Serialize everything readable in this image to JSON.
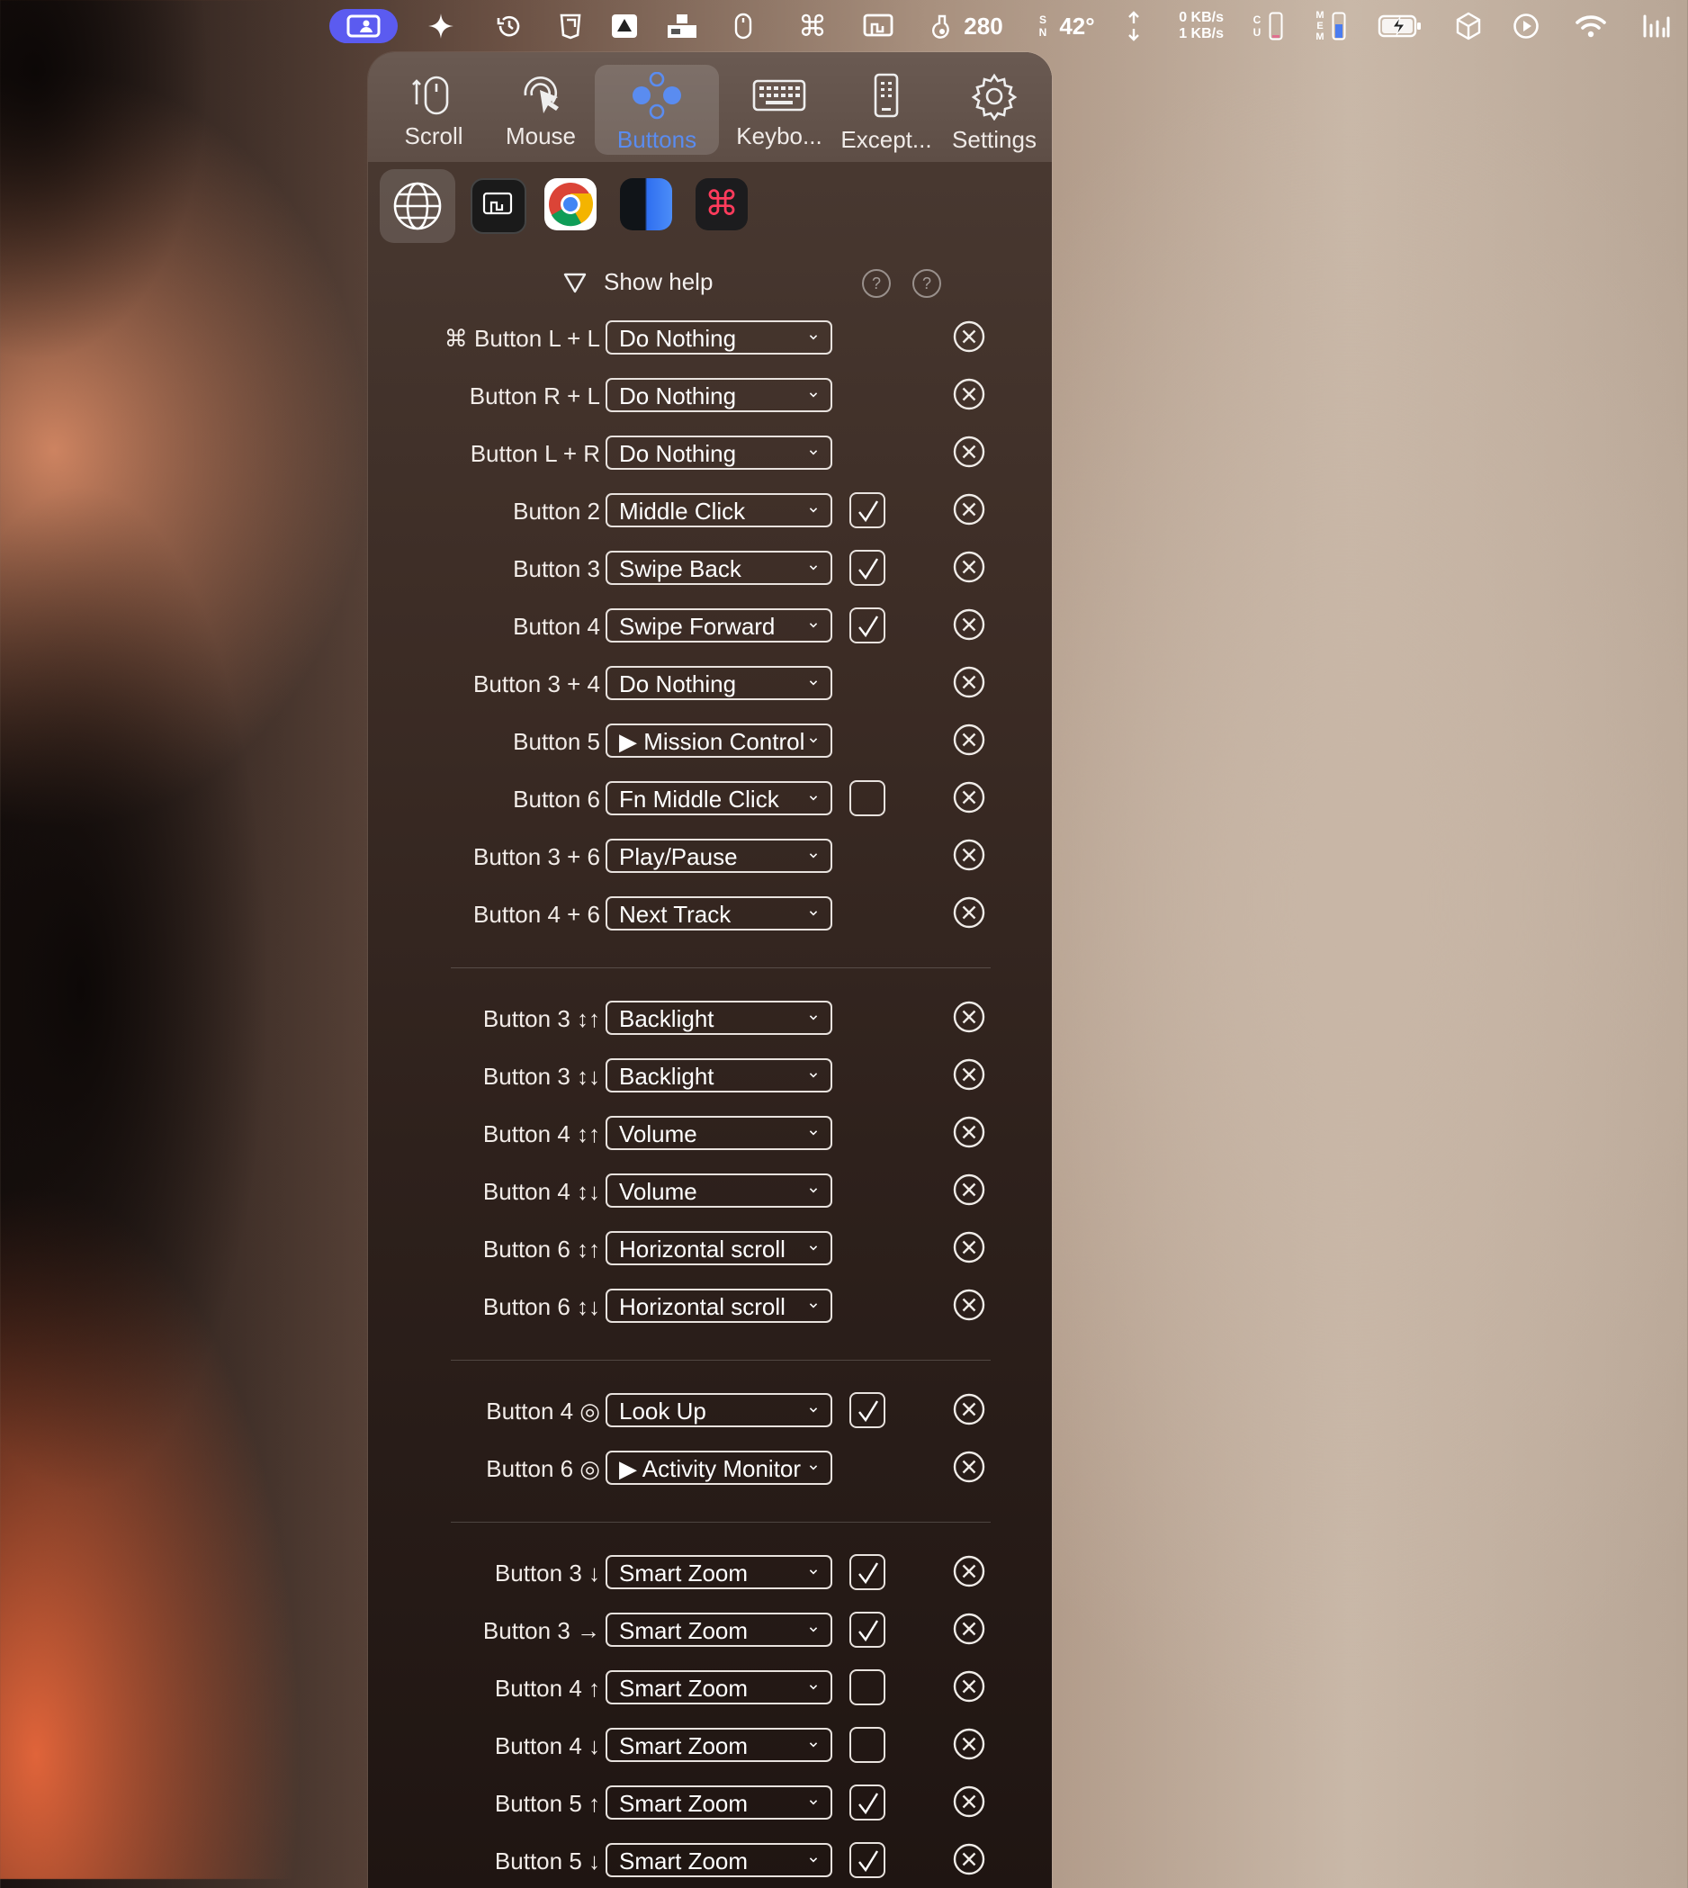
{
  "menubar": {
    "temp_count": "280",
    "temperature": "42°",
    "net_up": "0 KB/s",
    "net_down": "1 KB/s",
    "sensor_s": "S",
    "sensor_n": "N",
    "cpu_c": "C",
    "cpu_u": "U",
    "mem_m": "M",
    "mem_e": "E",
    "mem_m2": "M",
    "accent": "#5b5bf0"
  },
  "toolbar": {
    "tabs": [
      {
        "label": "Scroll",
        "icon": "scroll-icon"
      },
      {
        "label": "Mouse",
        "icon": "mouse-cursor-icon"
      },
      {
        "label": "Buttons",
        "icon": "buttons-icon"
      },
      {
        "label": "Keybo...",
        "icon": "keyboard-icon"
      },
      {
        "label": "Except...",
        "icon": "phone-icon"
      },
      {
        "label": "Settings",
        "icon": "gear-icon"
      }
    ],
    "active": "Buttons"
  },
  "apps": [
    "globe-icon",
    "screen-app-icon",
    "chrome-icon",
    "finder-icon",
    "shortcut-app-icon"
  ],
  "help": {
    "label": "Show help"
  },
  "groups": [
    [
      {
        "label": "⌘ Button L + L",
        "action": "Do Nothing",
        "checkbox": null
      },
      {
        "label": "Button R + L",
        "action": "Do Nothing",
        "checkbox": null
      },
      {
        "label": "Button L + R",
        "action": "Do Nothing",
        "checkbox": null
      },
      {
        "label": "Button 2",
        "action": "Middle Click",
        "checkbox": true
      },
      {
        "label": "Button 3",
        "action": "Swipe Back",
        "checkbox": true
      },
      {
        "label": "Button 4",
        "action": "Swipe Forward",
        "checkbox": true
      },
      {
        "label": "Button 3 + 4",
        "action": "Do Nothing",
        "checkbox": null
      },
      {
        "label": "Button 5",
        "action": "▶ Mission Control",
        "checkbox": null
      },
      {
        "label": "Button 6",
        "action": "Fn Middle Click",
        "checkbox": false
      },
      {
        "label": "Button 3 + 6",
        "action": "Play/Pause",
        "checkbox": null
      },
      {
        "label": "Button 4 + 6",
        "action": "Next Track",
        "checkbox": null
      }
    ],
    [
      {
        "label": "Button 3 ↕↑",
        "action": "Backlight",
        "checkbox": null
      },
      {
        "label": "Button 3 ↕↓",
        "action": "Backlight",
        "checkbox": null
      },
      {
        "label": "Button 4 ↕↑",
        "action": "Volume",
        "checkbox": null
      },
      {
        "label": "Button 4 ↕↓",
        "action": "Volume",
        "checkbox": null
      },
      {
        "label": "Button 6 ↕↑",
        "action": "Horizontal scroll",
        "checkbox": null
      },
      {
        "label": "Button 6 ↕↓",
        "action": "Horizontal scroll",
        "checkbox": null
      }
    ],
    [
      {
        "label": "Button 4 ◎",
        "action": "Look Up",
        "checkbox": true
      },
      {
        "label": "Button 6 ◎",
        "action": "▶ Activity Monitor",
        "checkbox": null
      }
    ],
    [
      {
        "label": "Button 3 ↓",
        "action": "Smart Zoom",
        "checkbox": true
      },
      {
        "label": "Button 3 →",
        "action": "Smart Zoom",
        "checkbox": true
      },
      {
        "label": "Button 4 ↑",
        "action": "Smart Zoom",
        "checkbox": false
      },
      {
        "label": "Button 4 ↓",
        "action": "Smart Zoom",
        "checkbox": false
      },
      {
        "label": "Button 5 ↑",
        "action": "Smart Zoom",
        "checkbox": true
      },
      {
        "label": "Button 5 ↓",
        "action": "Smart Zoom",
        "checkbox": true
      }
    ]
  ]
}
